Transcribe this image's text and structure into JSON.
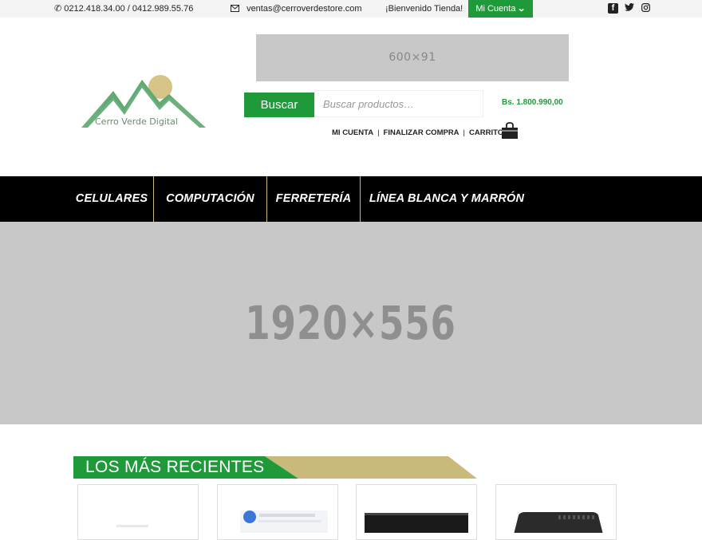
{
  "topbar": {
    "phone": "0212.418.34.00 / 0412.989.55.76",
    "email": "ventas@cerroverdestore.com",
    "welcome": "¡Bienvenido Tienda!",
    "account_button": "Mi Cuenta"
  },
  "header": {
    "ad_placeholder": "600×91",
    "logo_text": "Cerro Verde Digital",
    "search_button": "Buscar",
    "search_placeholder": "Buscar productos…",
    "cart_total": "Bs. 1.800.990,00",
    "links": [
      "MI CUENTA",
      "FINALIZAR COMPRA",
      "CARRITO"
    ]
  },
  "nav": {
    "items": [
      "CELULARES",
      "COMPUTACIÓN",
      "FERRETERÍA",
      "LÍNEA BLANCA Y MARRÓN"
    ]
  },
  "hero": {
    "placeholder": "1920×556"
  },
  "section": {
    "title": "LOS MÁS RECIENTES"
  },
  "colors": {
    "brand_green": "#1f9a3b",
    "gold": "#c9b97a",
    "nav_bg": "#000000",
    "placeholder_gray": "#c8c8c8"
  }
}
